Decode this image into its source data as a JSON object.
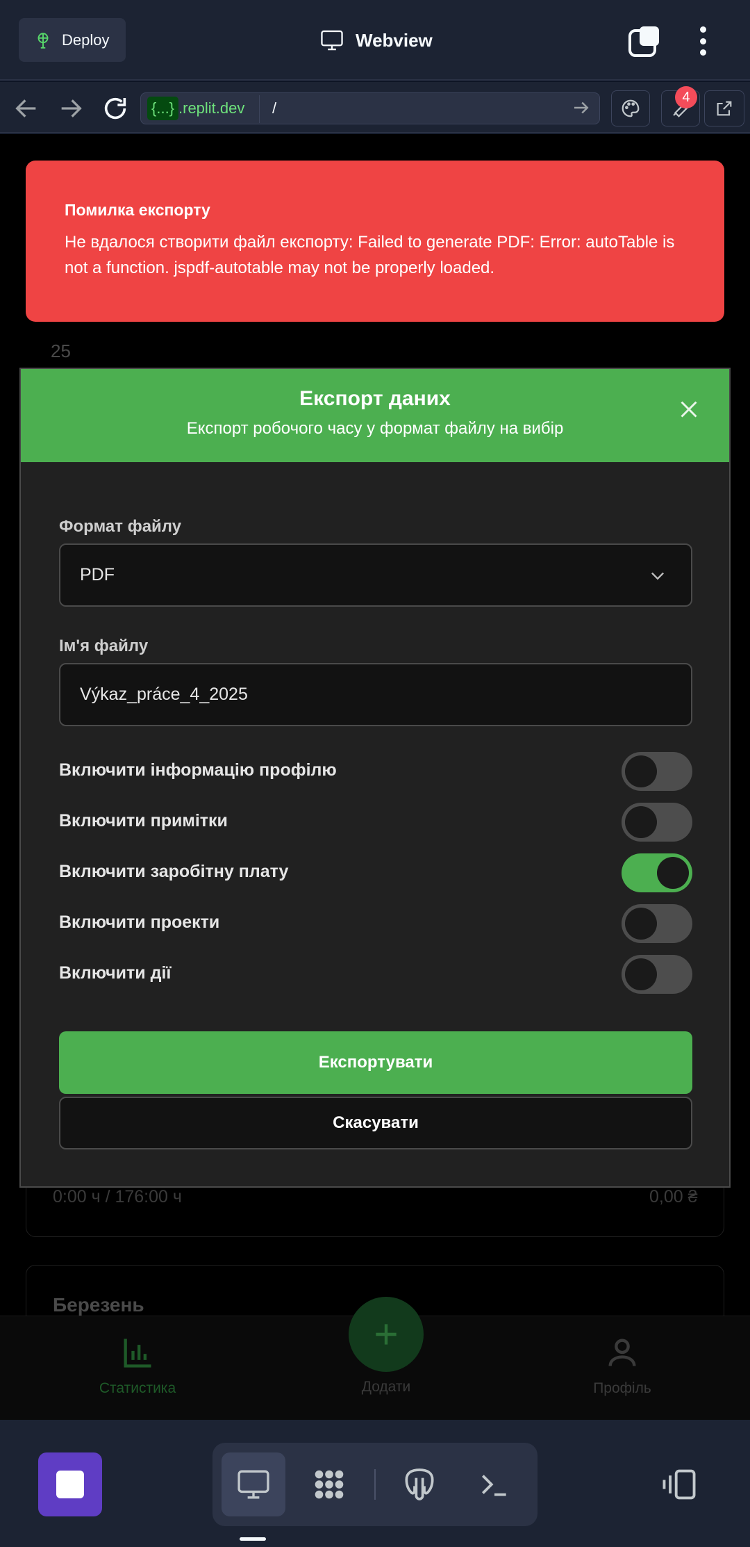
{
  "topbar": {
    "deploy_label": "Deploy",
    "title": "Webview"
  },
  "urlbar": {
    "domain_tag": "{...}",
    "domain": ".replit.dev",
    "path": "/",
    "notifications_count": "4"
  },
  "toast": {
    "title": "Помилка експорту",
    "message": "Не вдалося створити файл експорту: Failed to generate PDF: Error: autoTable is not a function. jspdf-autotable may not be properly loaded."
  },
  "background": {
    "card_number": "25",
    "hours": "0:00 ч / 176:00 ч",
    "amount": "0,00 ₴",
    "month": "Березень",
    "nav": {
      "stats": "Статистика",
      "add": "Додати",
      "profile": "Профіль"
    }
  },
  "modal": {
    "title": "Експорт даних",
    "subtitle": "Експорт робочого часу у формат файлу на вибір",
    "format_label": "Формат файлу",
    "format_value": "PDF",
    "filename_label": "Ім'я файлу",
    "filename_value": "Výkaz_práce_4_2025",
    "toggles": [
      {
        "label": "Включити інформацію профілю",
        "on": false
      },
      {
        "label": "Включити примітки",
        "on": false
      },
      {
        "label": "Включити заробітну плату",
        "on": true
      },
      {
        "label": "Включити проекти",
        "on": false
      },
      {
        "label": "Включити дії",
        "on": false
      }
    ],
    "export_label": "Експортувати",
    "cancel_label": "Скасувати"
  },
  "colors": {
    "accent_green": "#4caf50",
    "error_red": "#ef4444",
    "replit_bg": "#1c2333",
    "stop_purple": "#5f3dc4"
  },
  "icons": [
    "deploy-icon",
    "monitor-icon",
    "tabs-icon",
    "kebab-icon",
    "back-icon",
    "forward-icon",
    "reload-icon",
    "arrow-right-icon",
    "palette-icon",
    "wrench-icon",
    "external-link-icon",
    "close-icon",
    "chevron-down-icon",
    "chart-icon",
    "plus-icon",
    "user-icon",
    "stop-icon",
    "dots-grid-icon",
    "postgres-icon",
    "terminal-icon",
    "panels-icon"
  ]
}
